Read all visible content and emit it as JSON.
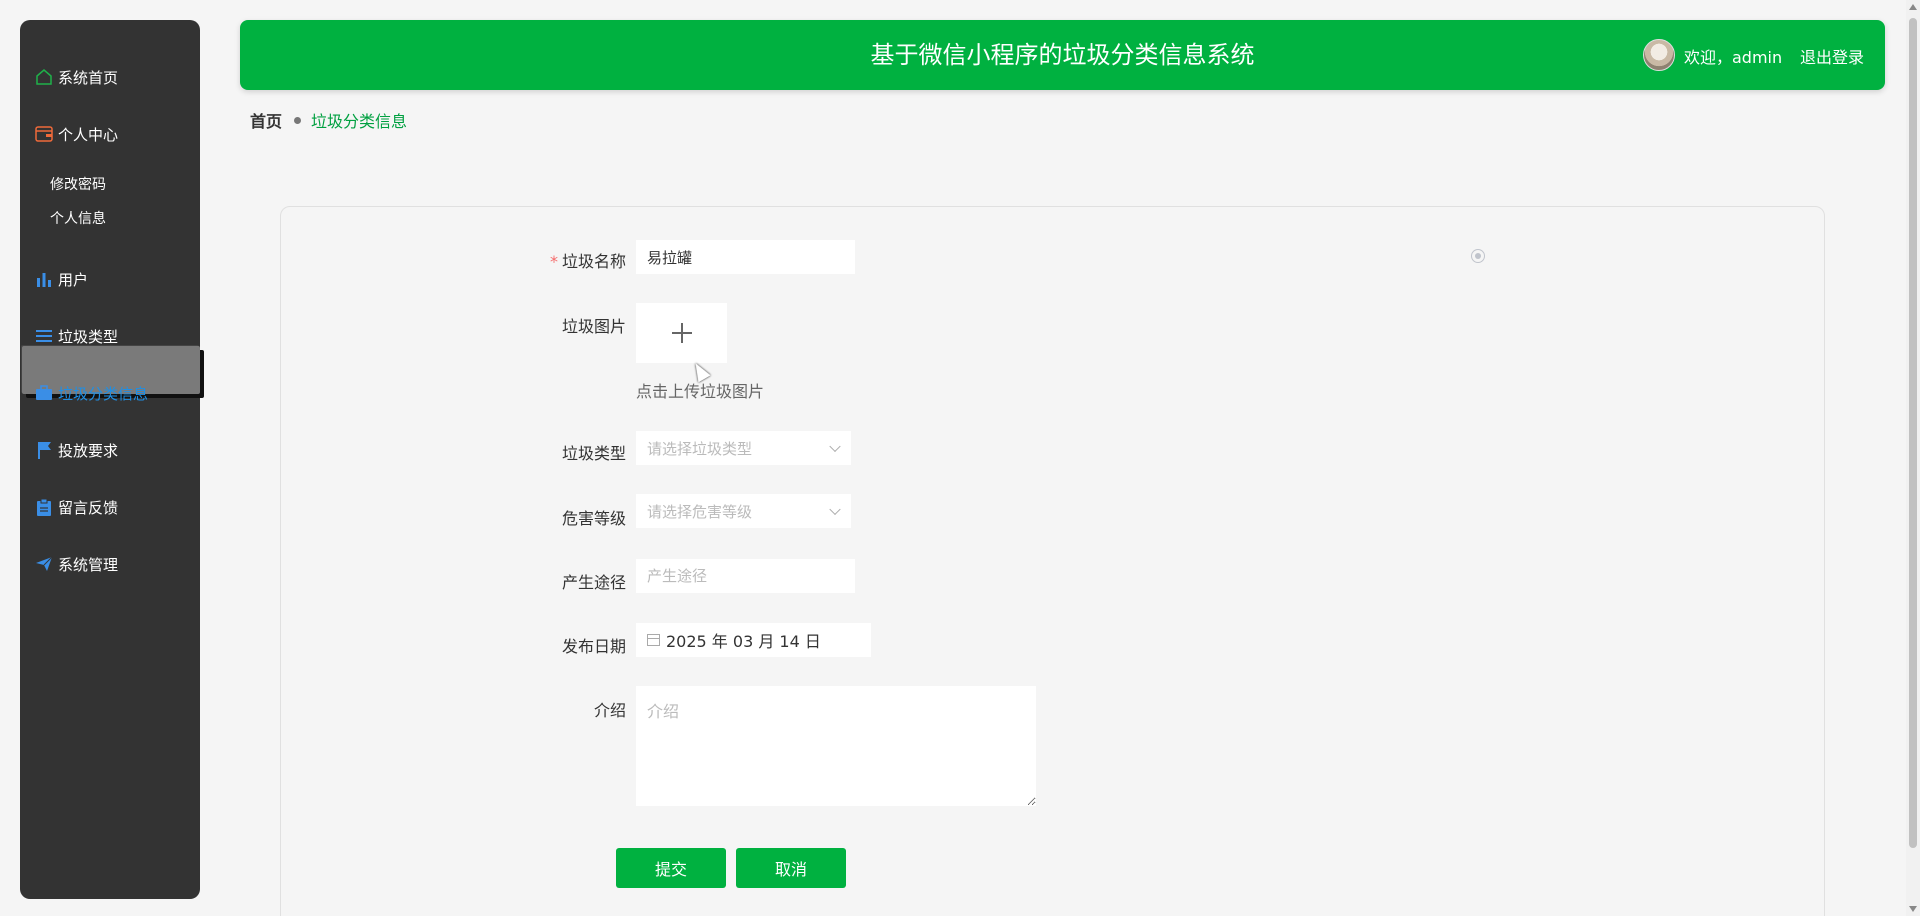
{
  "app_title": "基于微信小程序的垃圾分类信息系统",
  "header": {
    "welcome": "欢迎，admin",
    "logout": "退出登录"
  },
  "sidebar": {
    "items": [
      {
        "label": "系统首页",
        "icon": "home-icon"
      },
      {
        "label": "个人中心",
        "icon": "wallet-icon",
        "children": [
          "修改密码",
          "个人信息"
        ]
      },
      {
        "label": "用户",
        "icon": "bar-chart-icon"
      },
      {
        "label": "垃圾类型",
        "icon": "list-icon"
      },
      {
        "label": "垃圾分类信息",
        "icon": "briefcase-icon",
        "active": true
      },
      {
        "label": "投放要求",
        "icon": "flag-icon"
      },
      {
        "label": "留言反馈",
        "icon": "clipboard-icon"
      },
      {
        "label": "系统管理",
        "icon": "send-icon"
      }
    ]
  },
  "breadcrumb": {
    "home": "首页",
    "current": "垃圾分类信息"
  },
  "form": {
    "name": {
      "label": "垃圾名称",
      "value": "易拉罐",
      "required": true
    },
    "image": {
      "label": "垃圾图片",
      "hint": "点击上传垃圾图片"
    },
    "type": {
      "label": "垃圾类型",
      "placeholder": "请选择垃圾类型"
    },
    "hazard": {
      "label": "危害等级",
      "placeholder": "请选择危害等级"
    },
    "source": {
      "label": "产生途径",
      "placeholder": "产生途径"
    },
    "date": {
      "label": "发布日期",
      "value": "2025 年 03 月 14 日"
    },
    "intro": {
      "label": "介绍",
      "placeholder": "介绍"
    },
    "submit": "提交",
    "cancel": "取消"
  },
  "colors": {
    "primary": "#00b140",
    "sidebar_bg": "#333333",
    "active_text": "#1f8fe5",
    "page_bg": "#f5f5f5"
  }
}
